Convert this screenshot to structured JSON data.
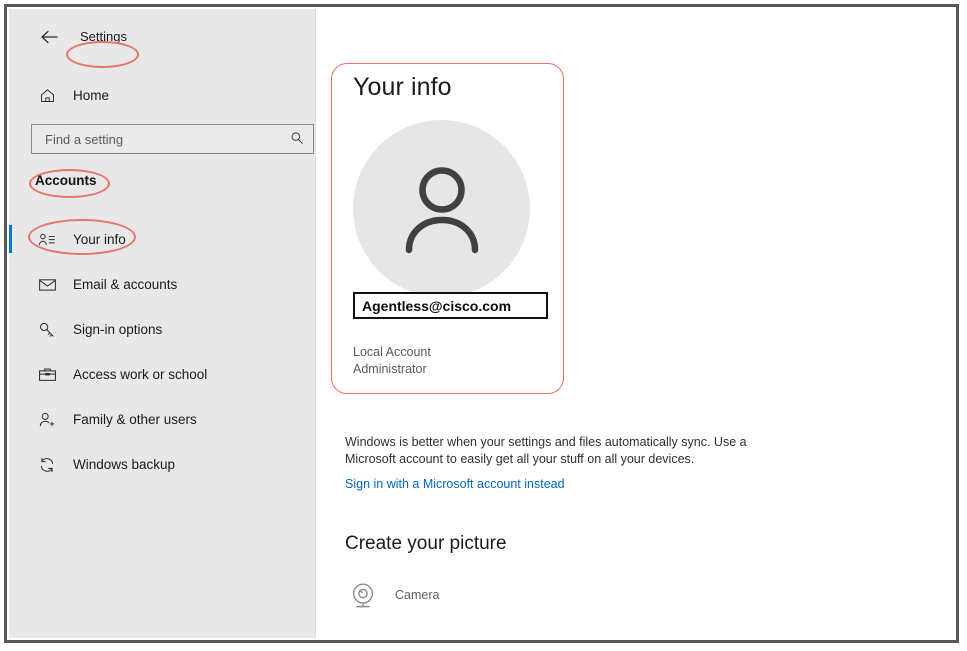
{
  "window": {
    "controls": {
      "minimize": "minimize-button",
      "maximize": "maximize-button",
      "close": "close-button"
    }
  },
  "sidebar": {
    "back_label": "←",
    "app_title": "Settings",
    "home": {
      "label": "Home",
      "icon": "home-icon"
    },
    "search": {
      "placeholder": "Find a setting",
      "value": "",
      "icon": "search-icon"
    },
    "section_heading": "Accounts",
    "items": [
      {
        "label": "Your info",
        "icon": "your-info-icon",
        "selected": true
      },
      {
        "label": "Email & accounts",
        "icon": "envelope-icon",
        "selected": false
      },
      {
        "label": "Sign-in options",
        "icon": "key-icon",
        "selected": false
      },
      {
        "label": "Access work or school",
        "icon": "briefcase-icon",
        "selected": false
      },
      {
        "label": "Family & other users",
        "icon": "person-add-icon",
        "selected": false
      },
      {
        "label": "Windows backup",
        "icon": "sync-icon",
        "selected": false
      }
    ]
  },
  "main": {
    "page_title": "Your info",
    "avatar_icon": "person-avatar-icon",
    "account_email": "Agentless@cisco.com",
    "account_type_line1": "Local Account",
    "account_type_line2": "Administrator",
    "sync_description": "Windows is better when your settings and files automatically sync. Use a Microsoft account to easily get all your stuff on all your devices.",
    "sync_link": "Sign in with a Microsoft account instead",
    "create_picture_heading": "Create your picture",
    "camera_label": "Camera",
    "camera_icon": "camera-icon"
  },
  "annotations": {
    "accent_color": "#e8736a",
    "highlight_border_color": "#111111",
    "selection_bar_color": "#0078d4"
  }
}
